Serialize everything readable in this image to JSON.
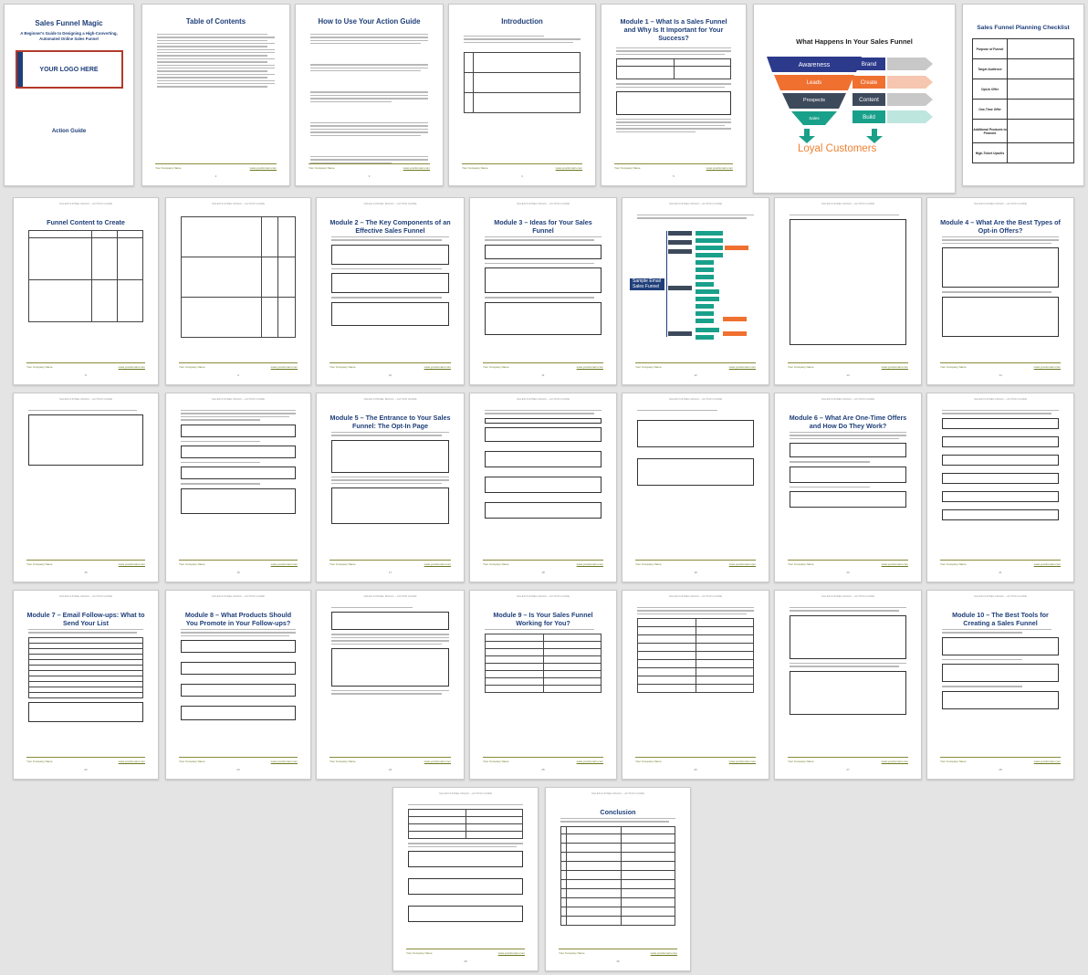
{
  "header": "SALES FUNNEL MAGIC – ACTION GUIDE",
  "footer": {
    "left": "Your Company Name",
    "right": "www.yourdomain.com"
  },
  "cover": {
    "title": "Sales Funnel Magic",
    "subtitle": "A Beginner's Guide to Designing a High-Converting, Automated Online Sales Funnel",
    "logo": "YOUR LOGO HERE",
    "label": "Action Guide"
  },
  "toc_title": "Table of Contents",
  "funnel_diagram": {
    "title": "What Happens In Your Sales Funnel",
    "stages": [
      "Awareness",
      "Leads",
      "Prospects",
      "Sales"
    ],
    "actions": [
      "Brand",
      "Create",
      "Content",
      "Build"
    ],
    "bottom": "Loyal Customers",
    "colors": {
      "awareness": "#2c3a8c",
      "leads": "#f07030",
      "prospects": "#3d4a5c",
      "sales": "#19a08a"
    }
  },
  "checklist": {
    "title": "Sales Funnel Planning Checklist",
    "rows": [
      "Purpose of Funnel",
      "Target Audience",
      "Opt-In Offer",
      "One-Time Offer",
      "Additional Products to Promote",
      "High-Ticket Upsells"
    ]
  },
  "pages": [
    {
      "num": "",
      "title": ""
    },
    {
      "num": "2",
      "title": "Table of Contents"
    },
    {
      "num": "3",
      "title": "How to Use Your Action Guide"
    },
    {
      "num": "4",
      "title": "Introduction"
    },
    {
      "num": "5",
      "title": "Module 1 – What Is a Sales Funnel and Why Is It Important for Your Success?"
    },
    {
      "num": "",
      "title": ""
    },
    {
      "num": "",
      "title": ""
    },
    {
      "num": "8",
      "title": "Funnel Content to Create"
    },
    {
      "num": "9",
      "title": ""
    },
    {
      "num": "10",
      "title": "Module 2 – The Key Components of an Effective Sales Funnel"
    },
    {
      "num": "11",
      "title": "Module 3 – Ideas for Your Sales Funnel"
    },
    {
      "num": "12",
      "title": ""
    },
    {
      "num": "13",
      "title": ""
    },
    {
      "num": "14",
      "title": "Module 4 – What Are the Best Types of Opt-in Offers?"
    },
    {
      "num": "15",
      "title": ""
    },
    {
      "num": "16",
      "title": ""
    },
    {
      "num": "17",
      "title": "Module 5 – The Entrance to Your Sales Funnel: The Opt-In Page"
    },
    {
      "num": "18",
      "title": ""
    },
    {
      "num": "19",
      "title": ""
    },
    {
      "num": "20",
      "title": "Module 6 – What Are One-Time Offers and How Do They Work?"
    },
    {
      "num": "21",
      "title": ""
    },
    {
      "num": "22",
      "title": "Module 7 – Email Follow-ups: What to Send Your List"
    },
    {
      "num": "23",
      "title": "Module 8 – What Products Should You Promote in Your Follow-ups?"
    },
    {
      "num": "24",
      "title": ""
    },
    {
      "num": "25",
      "title": "Module 9 – Is Your Sales Funnel Working for You?"
    },
    {
      "num": "26",
      "title": ""
    },
    {
      "num": "27",
      "title": ""
    },
    {
      "num": "28",
      "title": "Module 10 – The Best Tools for Creating a Sales Funnel"
    },
    {
      "num": "29",
      "title": ""
    },
    {
      "num": "30",
      "title": "Conclusion"
    }
  ],
  "mindmap_label": "Sample Email Sales Funnel"
}
